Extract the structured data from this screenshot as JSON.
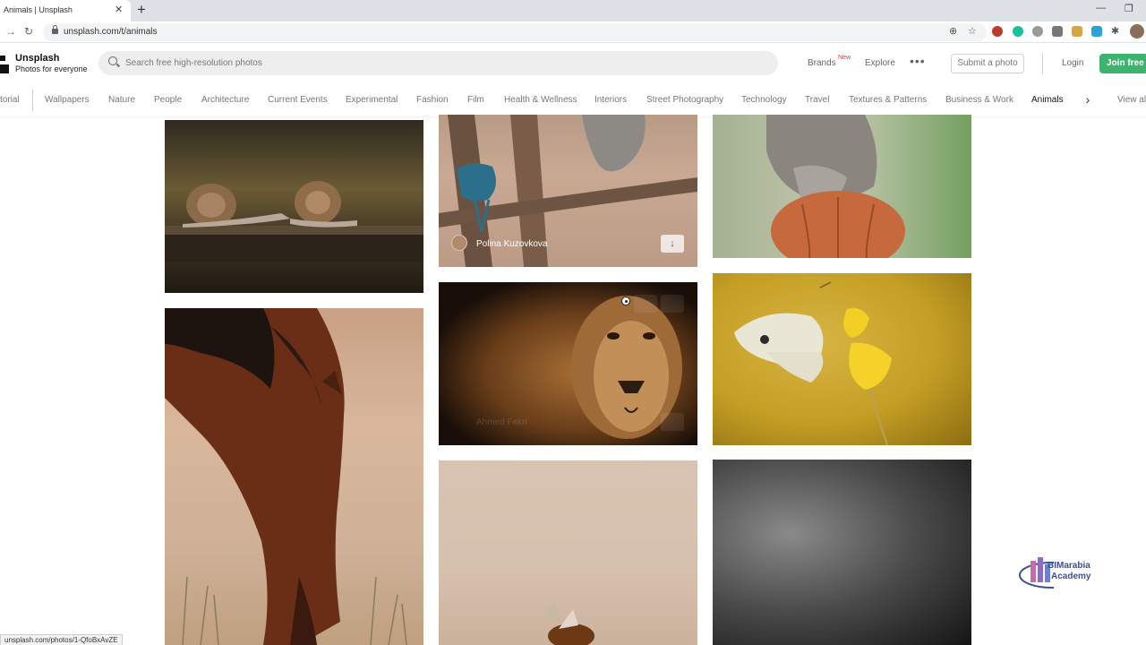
{
  "browser": {
    "tab_title": "Animals | Unsplash",
    "url": "unsplash.com/t/animals",
    "status_url": "unsplash.com/photos/1-QfoBxAvZE"
  },
  "header": {
    "brand_name": "Unsplash",
    "brand_tagline": "Photos for everyone",
    "search_placeholder": "Search free high-resolution photos",
    "brands_label": "Brands",
    "new_badge": "New",
    "explore_label": "Explore",
    "more_label": "•••",
    "submit_label": "Submit a photo",
    "login_label": "Login",
    "join_label": "Join free"
  },
  "topics": {
    "items": [
      {
        "label": "torial"
      },
      {
        "label": "Wallpapers"
      },
      {
        "label": "Nature"
      },
      {
        "label": "People"
      },
      {
        "label": "Architecture"
      },
      {
        "label": "Current Events"
      },
      {
        "label": "Experimental"
      },
      {
        "label": "Fashion"
      },
      {
        "label": "Film"
      },
      {
        "label": "Health & Wellness"
      },
      {
        "label": "Interiors"
      },
      {
        "label": "Street Photography"
      },
      {
        "label": "Technology"
      },
      {
        "label": "Travel"
      },
      {
        "label": "Textures & Patterns"
      },
      {
        "label": "Business & Work"
      },
      {
        "label": "Animals"
      }
    ],
    "active": "Animals",
    "view_all": "View al"
  },
  "photos": {
    "monkey_author": "Polina Kuzovkova",
    "lion_author": "Ahmed Fekri"
  },
  "watermark": {
    "line1": "BIMarabia",
    "line2": "Academy"
  },
  "colors": {
    "join_green": "#3cb46e",
    "active_topic": "#111111",
    "inactive_topic": "#767676"
  }
}
